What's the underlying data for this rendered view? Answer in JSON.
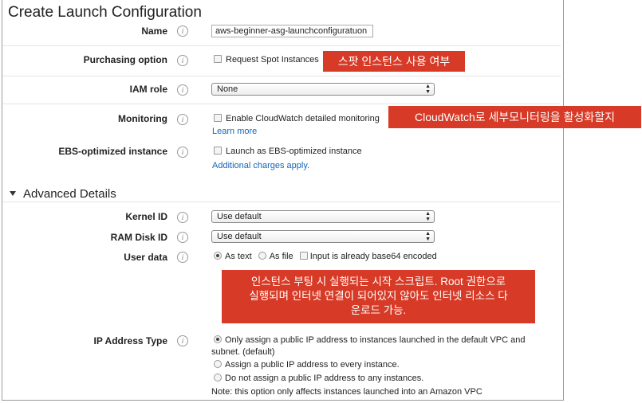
{
  "page_title": "Create Launch Configuration",
  "info_glyph": "i",
  "fields": {
    "name": {
      "label": "Name",
      "value": "aws-beginner-asg-launchconfiguratuon"
    },
    "purchasing": {
      "label": "Purchasing option",
      "checkbox": "Request Spot Instances"
    },
    "iam": {
      "label": "IAM role",
      "selected": "None"
    },
    "monitoring": {
      "label": "Monitoring",
      "checkbox": "Enable CloudWatch detailed monitoring",
      "link": "Learn more"
    },
    "ebs": {
      "label": "EBS-optimized instance",
      "checkbox": "Launch as EBS-optimized instance",
      "link": "Additional charges apply."
    }
  },
  "advanced": {
    "heading": "Advanced Details",
    "kernel": {
      "label": "Kernel ID",
      "selected": "Use default"
    },
    "ramdisk": {
      "label": "RAM Disk ID",
      "selected": "Use default"
    },
    "userdata": {
      "label": "User data",
      "opt_text": "As text",
      "opt_file": "As file",
      "base64": "Input is already base64 encoded"
    },
    "ip": {
      "label": "IP Address Type",
      "opt1_line1": "Only assign a public IP address to instances launched in the default VPC and",
      "opt1_line2": "subnet. (default)",
      "opt2": "Assign a public IP address to every instance.",
      "opt3": "Do not assign a public IP address to any instances.",
      "note": "Note: this option only affects instances launched into an Amazon VPC"
    }
  },
  "callouts": {
    "spot": "스팟 인스턴스 사용 여부",
    "cloudwatch": "CloudWatch로 세부모니터링을 활성화할지",
    "userdata_line1": "인스턴스 부팅 시 실행되는 시작 스크립트. Root 권한으로",
    "userdata_line2": "실행되며 인터넷 연결이 되어있지 않아도 인터넷 리소스 다",
    "userdata_line3": "운로드 가능."
  },
  "colors": {
    "callout_bg": "#d73a26",
    "link": "#1166bb"
  }
}
